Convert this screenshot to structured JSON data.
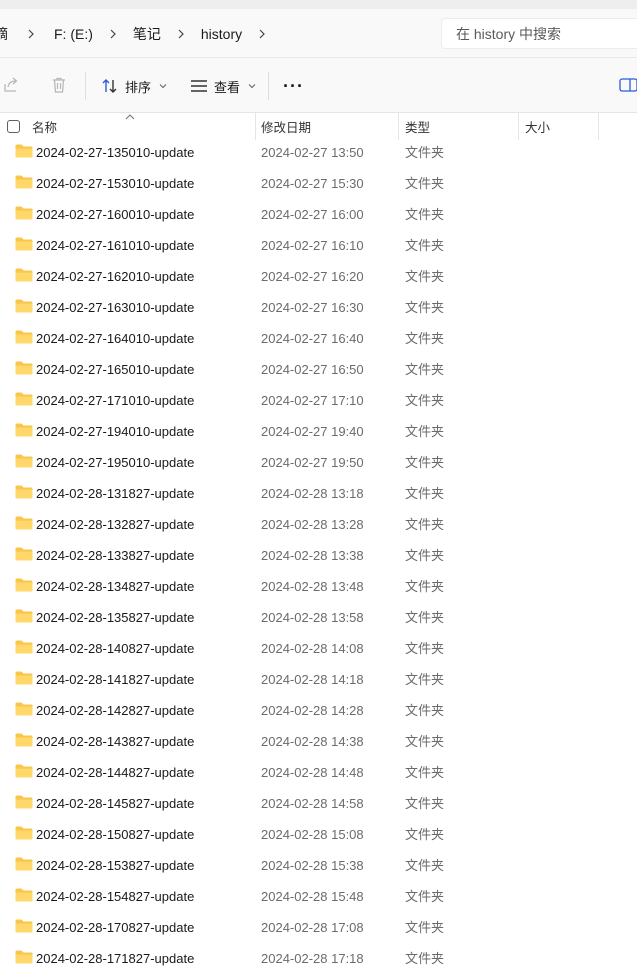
{
  "addressbar": {
    "crumbs": [
      "摘",
      "F: (E:)",
      "笔记",
      "history"
    ],
    "search_placeholder": "在 history 中搜索"
  },
  "toolbar": {
    "share_icon": "share-icon",
    "delete_icon": "trash-icon",
    "sort_label": "排序",
    "view_label": "查看",
    "more_label": "···",
    "details_pane_icon": "details-pane-icon"
  },
  "columns": {
    "name": "名称",
    "modified": "修改日期",
    "type": "类型",
    "size": "大小"
  },
  "accent_color": "#0067c0",
  "folder_color": "#f8c648",
  "files": [
    {
      "name": "2024-02-27-135010-update",
      "modified": "2024-02-27 13:50",
      "type": "文件夹",
      "size": ""
    },
    {
      "name": "2024-02-27-153010-update",
      "modified": "2024-02-27 15:30",
      "type": "文件夹",
      "size": ""
    },
    {
      "name": "2024-02-27-160010-update",
      "modified": "2024-02-27 16:00",
      "type": "文件夹",
      "size": ""
    },
    {
      "name": "2024-02-27-161010-update",
      "modified": "2024-02-27 16:10",
      "type": "文件夹",
      "size": ""
    },
    {
      "name": "2024-02-27-162010-update",
      "modified": "2024-02-27 16:20",
      "type": "文件夹",
      "size": ""
    },
    {
      "name": "2024-02-27-163010-update",
      "modified": "2024-02-27 16:30",
      "type": "文件夹",
      "size": ""
    },
    {
      "name": "2024-02-27-164010-update",
      "modified": "2024-02-27 16:40",
      "type": "文件夹",
      "size": ""
    },
    {
      "name": "2024-02-27-165010-update",
      "modified": "2024-02-27 16:50",
      "type": "文件夹",
      "size": ""
    },
    {
      "name": "2024-02-27-171010-update",
      "modified": "2024-02-27 17:10",
      "type": "文件夹",
      "size": ""
    },
    {
      "name": "2024-02-27-194010-update",
      "modified": "2024-02-27 19:40",
      "type": "文件夹",
      "size": ""
    },
    {
      "name": "2024-02-27-195010-update",
      "modified": "2024-02-27 19:50",
      "type": "文件夹",
      "size": ""
    },
    {
      "name": "2024-02-28-131827-update",
      "modified": "2024-02-28 13:18",
      "type": "文件夹",
      "size": ""
    },
    {
      "name": "2024-02-28-132827-update",
      "modified": "2024-02-28 13:28",
      "type": "文件夹",
      "size": ""
    },
    {
      "name": "2024-02-28-133827-update",
      "modified": "2024-02-28 13:38",
      "type": "文件夹",
      "size": ""
    },
    {
      "name": "2024-02-28-134827-update",
      "modified": "2024-02-28 13:48",
      "type": "文件夹",
      "size": ""
    },
    {
      "name": "2024-02-28-135827-update",
      "modified": "2024-02-28 13:58",
      "type": "文件夹",
      "size": ""
    },
    {
      "name": "2024-02-28-140827-update",
      "modified": "2024-02-28 14:08",
      "type": "文件夹",
      "size": ""
    },
    {
      "name": "2024-02-28-141827-update",
      "modified": "2024-02-28 14:18",
      "type": "文件夹",
      "size": ""
    },
    {
      "name": "2024-02-28-142827-update",
      "modified": "2024-02-28 14:28",
      "type": "文件夹",
      "size": ""
    },
    {
      "name": "2024-02-28-143827-update",
      "modified": "2024-02-28 14:38",
      "type": "文件夹",
      "size": ""
    },
    {
      "name": "2024-02-28-144827-update",
      "modified": "2024-02-28 14:48",
      "type": "文件夹",
      "size": ""
    },
    {
      "name": "2024-02-28-145827-update",
      "modified": "2024-02-28 14:58",
      "type": "文件夹",
      "size": ""
    },
    {
      "name": "2024-02-28-150827-update",
      "modified": "2024-02-28 15:08",
      "type": "文件夹",
      "size": ""
    },
    {
      "name": "2024-02-28-153827-update",
      "modified": "2024-02-28 15:38",
      "type": "文件夹",
      "size": ""
    },
    {
      "name": "2024-02-28-154827-update",
      "modified": "2024-02-28 15:48",
      "type": "文件夹",
      "size": ""
    },
    {
      "name": "2024-02-28-170827-update",
      "modified": "2024-02-28 17:08",
      "type": "文件夹",
      "size": ""
    },
    {
      "name": "2024-02-28-171827-update",
      "modified": "2024-02-28 17:18",
      "type": "文件夹",
      "size": ""
    }
  ]
}
